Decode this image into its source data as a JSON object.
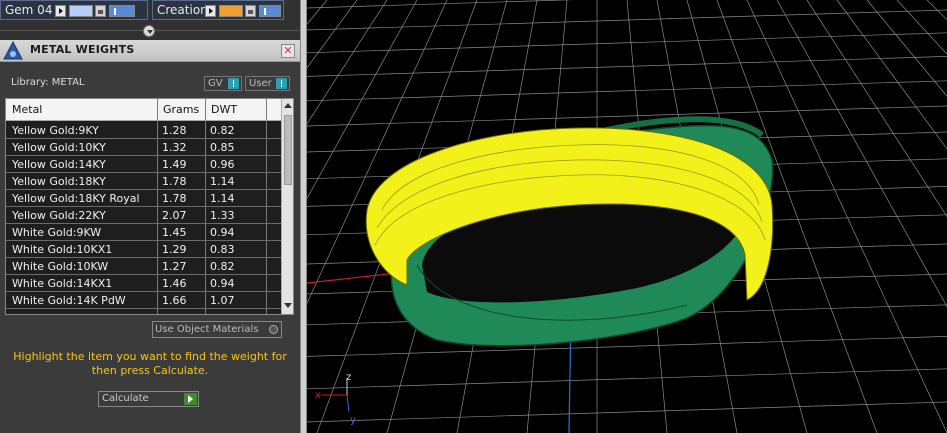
{
  "layers": [
    {
      "name": "Gem 04",
      "color": "#b8cdf5"
    },
    {
      "name": "Creation",
      "color": "#f0a030"
    }
  ],
  "panel": {
    "title": "METAL WEIGHTS",
    "close_label": "✕",
    "library_label": "Library: METAL",
    "gv_label": "GV",
    "user_label": "User"
  },
  "table": {
    "columns": [
      "Metal",
      "Grams",
      "DWT"
    ],
    "rows": [
      {
        "metal": "Yellow Gold:9KY",
        "grams": "1.28",
        "dwt": "0.82"
      },
      {
        "metal": "Yellow Gold:10KY",
        "grams": "1.32",
        "dwt": "0.85"
      },
      {
        "metal": "Yellow Gold:14KY",
        "grams": "1.49",
        "dwt": "0.96"
      },
      {
        "metal": "Yellow Gold:18KY",
        "grams": "1.78",
        "dwt": "1.14"
      },
      {
        "metal": "Yellow Gold:18KY Royal",
        "grams": "1.78",
        "dwt": "1.14"
      },
      {
        "metal": "Yellow Gold:22KY",
        "grams": "2.07",
        "dwt": "1.33"
      },
      {
        "metal": "White Gold:9KW",
        "grams": "1.45",
        "dwt": "0.94"
      },
      {
        "metal": "White Gold:10KX1",
        "grams": "1.29",
        "dwt": "0.83"
      },
      {
        "metal": "White Gold:10KW",
        "grams": "1.27",
        "dwt": "0.82"
      },
      {
        "metal": "White Gold:14KX1",
        "grams": "1.46",
        "dwt": "0.94"
      },
      {
        "metal": "White Gold:14K PdW",
        "grams": "1.66",
        "dwt": "1.07"
      }
    ]
  },
  "use_object_materials_label": "Use Object Materials",
  "instruction": "Highlight the item you want to find the weight for then press Calculate.",
  "calculate_label": "Calculate",
  "viewport": {
    "axis_labels": {
      "z": "z",
      "x": "x",
      "y": "y"
    },
    "colors": {
      "grid": "#8a8a8a",
      "ring_yellow": "#f2f21a",
      "ring_green": "#1f8a58",
      "axis_red": "#c8201c",
      "axis_blue": "#2f6fd8"
    }
  }
}
